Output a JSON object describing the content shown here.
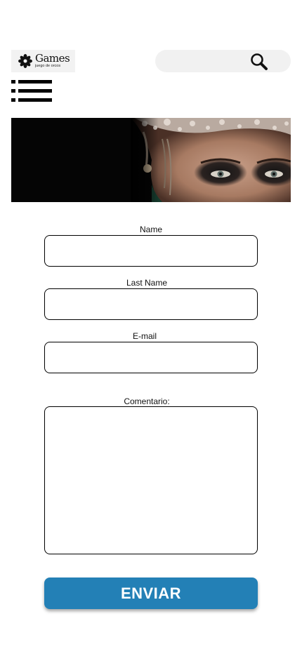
{
  "header": {
    "logo_title": "Games",
    "logo_subtitle": "juego de orcos",
    "search_placeholder": "",
    "icons": {
      "search": "search-icon",
      "menu": "hamburger-menu-icon",
      "logo": "flower-icon"
    }
  },
  "form": {
    "name_label": "Name",
    "name_value": "",
    "last_name_label": "Last Name",
    "last_name_value": "",
    "email_label": "E-mail",
    "email_value": "",
    "comment_label": "Comentario:",
    "comment_value": "",
    "submit_label": "ENVIAR"
  },
  "colors": {
    "accent": "#2380b6",
    "search_bg": "#f1f1f1"
  }
}
